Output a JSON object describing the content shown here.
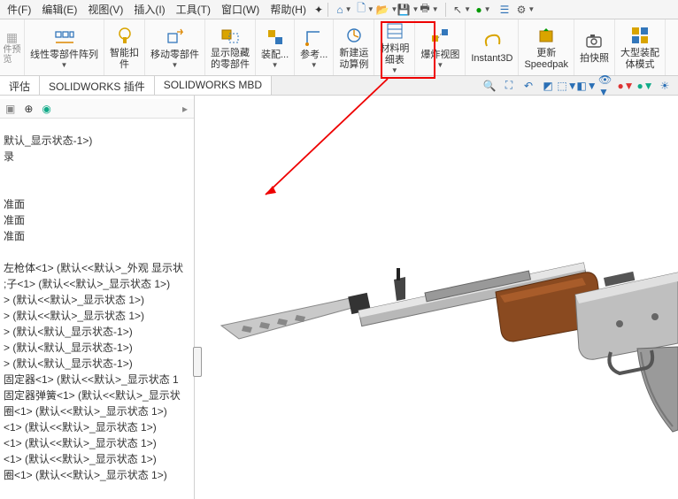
{
  "menubar": {
    "items": [
      "件(F)",
      "编辑(E)",
      "视图(V)",
      "插入(I)",
      "工具(T)",
      "窗口(W)",
      "帮助(H)"
    ]
  },
  "ribbon": {
    "groups": [
      {
        "label_line1": "线性零部件阵列",
        "label_line2": ""
      },
      {
        "label_line1": "智能扣",
        "label_line2": "件"
      },
      {
        "label_line1": "移动零部件",
        "label_line2": ""
      },
      {
        "label_line1": "显示隐藏",
        "label_line2": "的零部件"
      },
      {
        "label_line1": "装配...",
        "label_line2": ""
      },
      {
        "label_line1": "参考...",
        "label_line2": ""
      },
      {
        "label_line1": "新建运",
        "label_line2": "动算例"
      },
      {
        "label_line1": "材料明",
        "label_line2": "细表"
      },
      {
        "label_line1": "爆炸视图",
        "label_line2": ""
      },
      {
        "label_line1": "Instant3D",
        "label_line2": ""
      },
      {
        "label_line1": "更新",
        "label_line2": "Speedpak"
      },
      {
        "label_line1": "拍快照",
        "label_line2": ""
      },
      {
        "label_line1": "大型装配",
        "label_line2": "体模式"
      }
    ]
  },
  "tabs": {
    "items": [
      "评估",
      "SOLIDWORKS 插件",
      "SOLIDWORKS MBD"
    ]
  },
  "tree": {
    "items": [
      "默认_显示状态-1>)",
      "录",
      "",
      "",
      "准面",
      "准面",
      "准面",
      "",
      "左枪体<1> (默认<<默认>_外观 显示状",
      ";子<1> (默认<<默认>_显示状态 1>)",
      "> (默认<<默认>_显示状态 1>)",
      "> (默认<<默认>_显示状态 1>)",
      "> (默认<默认_显示状态-1>)",
      "> (默认<默认_显示状态-1>)",
      "> (默认<默认_显示状态-1>)",
      "固定器<1> (默认<<默认>_显示状态 1",
      "固定器弹簧<1> (默认<<默认>_显示状",
      "圈<1> (默认<<默认>_显示状态 1>)",
      "<1> (默认<<默认>_显示状态 1>)",
      "<1> (默认<<默认>_显示状态 1>)",
      "<1> (默认<<默认>_显示状态 1>)",
      "圈<1> (默认<<默认>_显示状态 1>)"
    ]
  }
}
